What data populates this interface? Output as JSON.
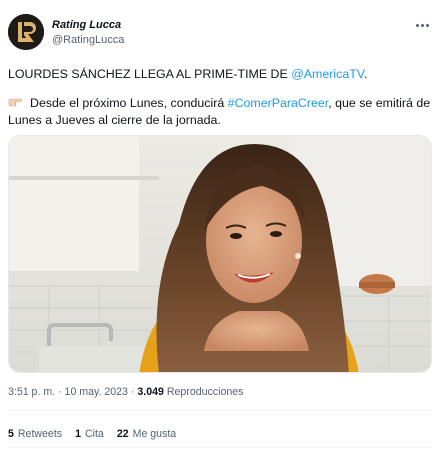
{
  "author": {
    "name": "Rating Lucca",
    "handle": "@RatingLucca"
  },
  "tweet": {
    "line1_text": "LOURDES SÁNCHEZ LLEGA AL PRIME-TIME DE ",
    "line1_mention": "@AmericaTV",
    "line1_end": ".",
    "line2_pre": "Desde el próximo Lunes, conducirá ",
    "line2_hashtag": "#ComerParaCreer",
    "line2_post": ", que se emitirá de",
    "line3": "Lunes a Jueves al cierre de la jornada."
  },
  "meta": {
    "time": "3:51 p. m.",
    "separator": "·",
    "date": "10 may. 2023",
    "views": "3.049",
    "views_label": "Reproducciones"
  },
  "stats": {
    "retweets_count": "5",
    "retweets_label": "Retweets",
    "quotes_count": "1",
    "quotes_label": "Cita",
    "likes_count": "22",
    "likes_label": "Me gusta"
  },
  "icons": {
    "avatar_logo": "LR-logo-icon",
    "pointing": "backhand-index-pointing-right-icon",
    "more": "more-dots-icon"
  },
  "colors": {
    "link": "#1d9bf0",
    "text": "#0f1419",
    "secondary": "#536471",
    "dress": "#e8a21a"
  }
}
